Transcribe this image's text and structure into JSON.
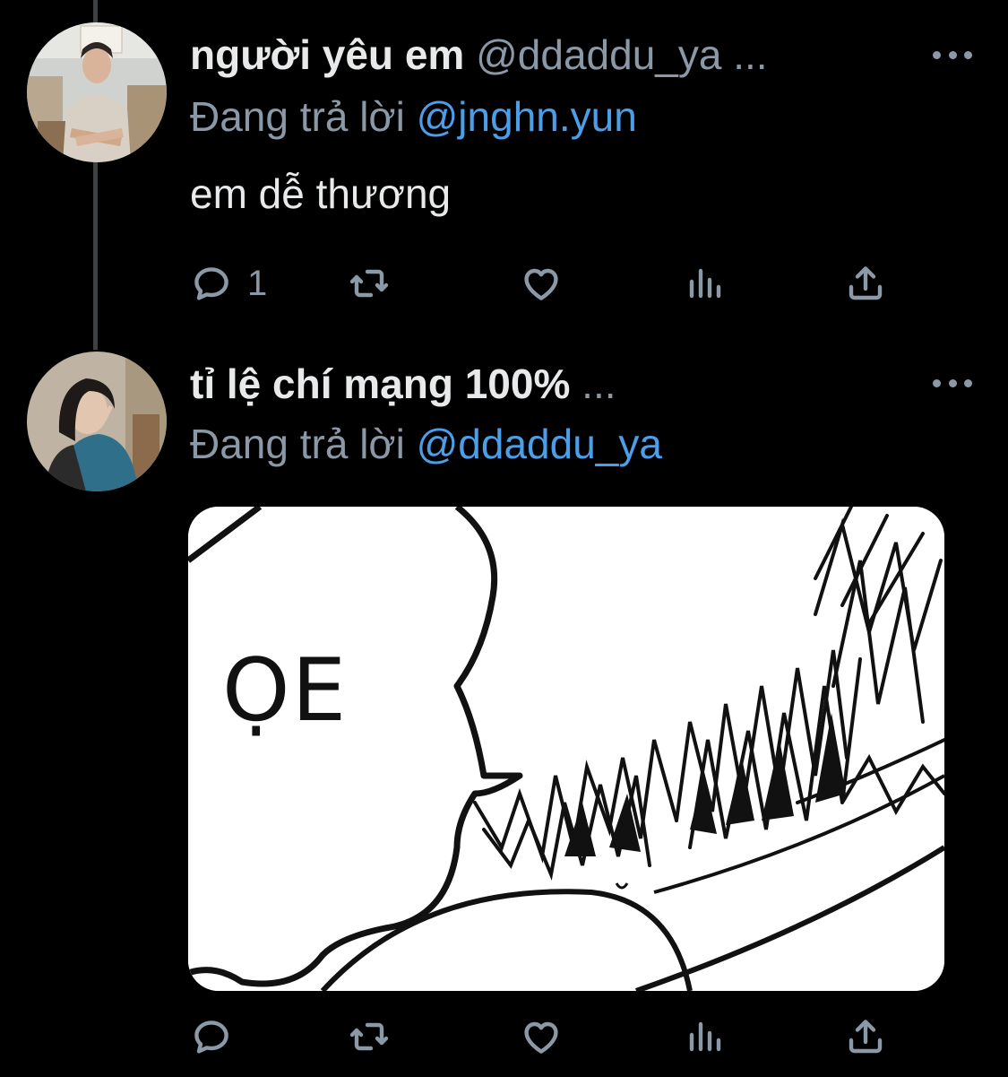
{
  "tweets": [
    {
      "display_name": "người yêu em",
      "handle": "@ddaddu_ya",
      "truncation": " ...",
      "reply_prefix": "Đang trả lời",
      "reply_to": "@jnghn.yun",
      "text": "em dễ thương",
      "reply_count": "1",
      "avatar_icon": "user-avatar-photo"
    },
    {
      "display_name": "tỉ lệ chí mạng 100%",
      "truncation": " ...",
      "reply_prefix": "Đang trả lời",
      "reply_to": "@ddaddu_ya",
      "media_text": "ỌE",
      "reply_count": "",
      "avatar_icon": "user-avatar-photo"
    }
  ],
  "colors": {
    "background": "#000000",
    "primary_text": "#e7e9ea",
    "secondary_text": "#8b98a5",
    "link": "#4d9ee9",
    "thread_line": "#3e4144"
  },
  "action_icons": [
    "reply-icon",
    "retweet-icon",
    "like-icon",
    "analytics-icon",
    "share-icon"
  ]
}
